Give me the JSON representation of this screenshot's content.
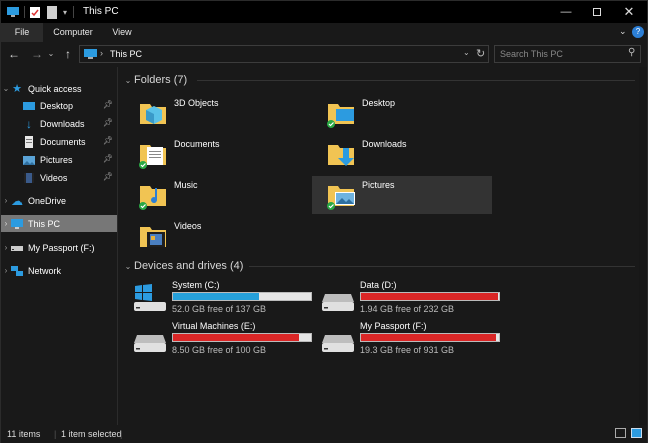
{
  "window": {
    "title": "This PC"
  },
  "ribbon": {
    "tabs": [
      "File",
      "Computer",
      "View"
    ]
  },
  "address": {
    "path": "This PC",
    "search_placeholder": "Search This PC"
  },
  "nav": {
    "quick_access": "Quick access",
    "pinned": [
      "Desktop",
      "Downloads",
      "Documents",
      "Pictures",
      "Videos"
    ],
    "onedrive": "OneDrive",
    "this_pc": "This PC",
    "my_passport": "My Passport (F:)",
    "network": "Network"
  },
  "folders": {
    "header": "Folders (7)",
    "items": [
      "3D Objects",
      "Desktop",
      "Documents",
      "Downloads",
      "Music",
      "Pictures",
      "Videos"
    ]
  },
  "drives": {
    "header": "Devices and drives (4)",
    "items": [
      {
        "name": "System (C:)",
        "free": "52.0 GB free of 137 GB",
        "used_fraction": 0.62,
        "color": "#26a0da"
      },
      {
        "name": "Data (D:)",
        "free": "1.94 GB free of 232 GB",
        "used_fraction": 0.99,
        "color": "#da2626"
      },
      {
        "name": "Virtual Machines (E:)",
        "free": "8.50 GB free of 100 GB",
        "used_fraction": 0.915,
        "color": "#da2626"
      },
      {
        "name": "My Passport (F:)",
        "free": "19.3 GB free of 931 GB",
        "used_fraction": 0.98,
        "color": "#da2626"
      }
    ]
  },
  "status": {
    "count": "11 items",
    "selected": "1 item selected"
  },
  "colors": {
    "folder_yellow": "#f1c453",
    "accent_blue": "#2c9be0",
    "sync_green": "#2aa845",
    "bar_red": "#da2626",
    "bar_blue": "#26a0da"
  }
}
